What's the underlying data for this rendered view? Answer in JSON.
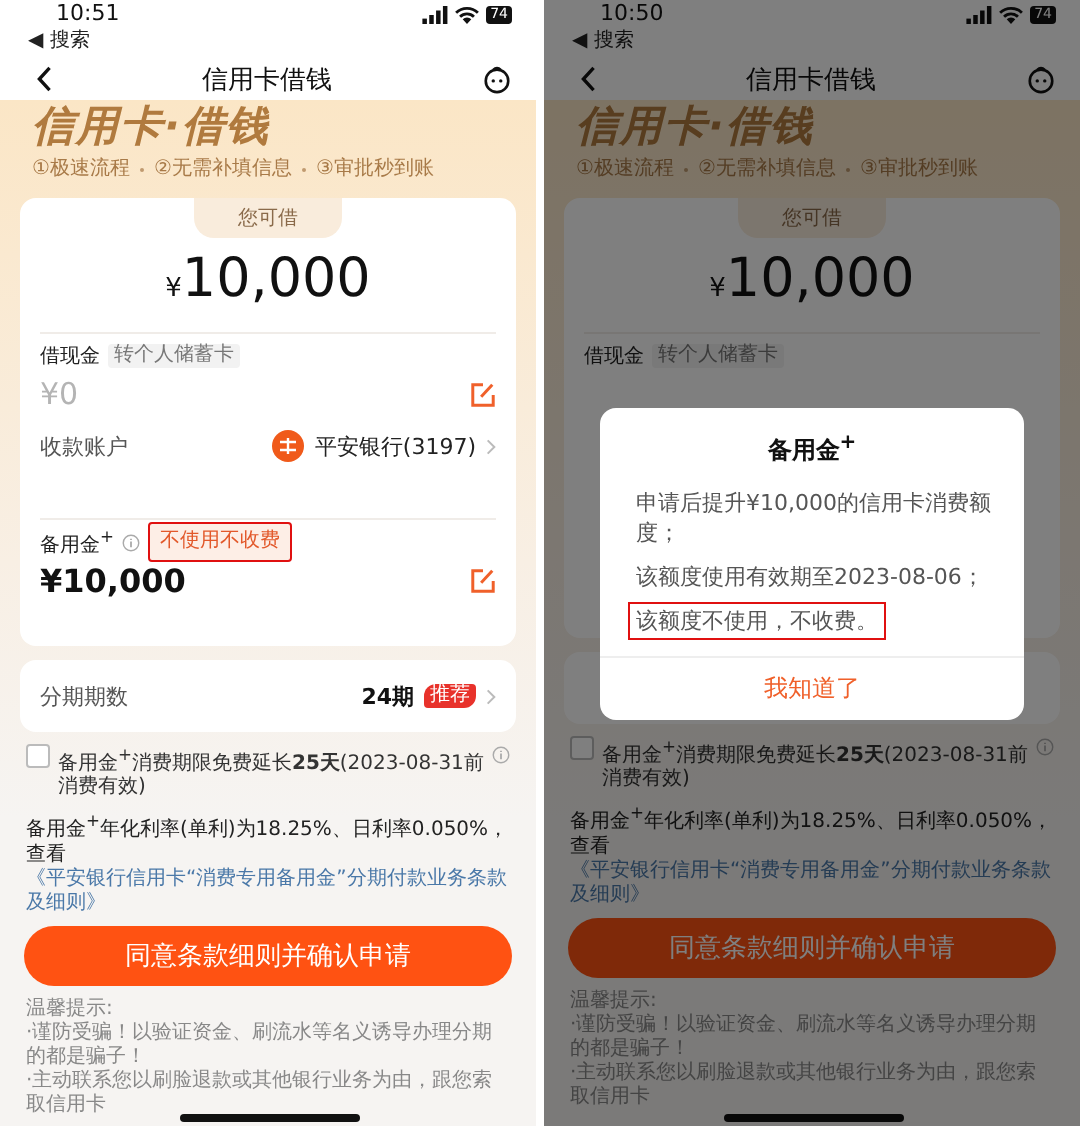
{
  "screens": [
    {
      "status_bar": {
        "time": "10:51",
        "back_app": "◀ 搜索",
        "battery": "74"
      },
      "nav": {
        "title": "信用卡借钱"
      },
      "hero": {
        "title": "信用卡·借钱",
        "steps": [
          "①极速流程",
          "②无需补填信息",
          "③审批秒到账"
        ]
      },
      "limit": {
        "label": "您可借",
        "currency": "¥",
        "amount": "10,000"
      },
      "cash": {
        "label": "借现金",
        "tag": "转个人储蓄卡",
        "amount": "¥0",
        "account_label": "收款账户",
        "account": "平安银行(3197)"
      },
      "standby": {
        "label": "备用金$^{+}$",
        "tag": "不使用不收费",
        "tag_highlighted": true,
        "amount": "¥10,000"
      },
      "installment": {
        "label": "分期期数",
        "value": "24期",
        "badge": "推荐"
      },
      "extension": {
        "checked": false,
        "text": "备用金$^{+}$消费期限免费延长**25天**(2023-08-31前消费有效)"
      },
      "rate": {
        "text": "备用金$^{+}$年化利率(单利)为18.25%、日利率0.050%，查看",
        "link": "《平安银行信用卡“消费专用备用金”分期付款业务条款及细则》"
      },
      "submit": "同意条款细则并确认申请",
      "tips": {
        "title": "温馨提示:",
        "items": [
          "·谨防受骗！以验证资金、刷流水等名义诱导办理分期的都是骗子！",
          "·主动联系您以刷脸退款或其他银行业务为由，跟您索取信用卡"
        ]
      }
    },
    {
      "status_bar": {
        "time": "10:50",
        "back_app": "◀ 搜索",
        "battery": "74"
      },
      "nav": {
        "title": "信用卡借钱"
      },
      "hero": {
        "title": "信用卡·借钱",
        "steps": [
          "①极速流程",
          "②无需补填信息",
          "③审批秒到账"
        ]
      },
      "limit": {
        "label": "您可借",
        "currency": "¥",
        "amount": "10,000"
      },
      "cash": {
        "label": "借现金",
        "tag": "转个人储蓄卡"
      },
      "extension": {
        "checked": false,
        "text": "备用金$^{+}$消费期限免费延长**25天**(2023-08-31前消费有效)"
      },
      "rate": {
        "text": "备用金$^{+}$年化利率(单利)为18.25%、日利率0.050%，查看",
        "link": "《平安银行信用卡“消费专用备用金”分期付款业务条款及细则》"
      },
      "submit": "同意条款细则并确认申请",
      "tips": {
        "title": "温馨提示:",
        "items": [
          "·谨防受骗！以验证资金、刷流水等名义诱导办理分期的都是骗子！",
          "·主动联系您以刷脸退款或其他银行业务为由，跟您索取信用卡"
        ]
      },
      "dialog": {
        "title": "备用金$^{+}$",
        "items": [
          {
            "text": "申请后提升¥10,000的信用卡消费额度；",
            "highlighted": false
          },
          {
            "text": "该额度使用有效期至2023-08-06；",
            "highlighted": false
          },
          {
            "text": "该额度不使用，不收费。",
            "highlighted": true
          }
        ],
        "button": "我知道了"
      }
    }
  ]
}
